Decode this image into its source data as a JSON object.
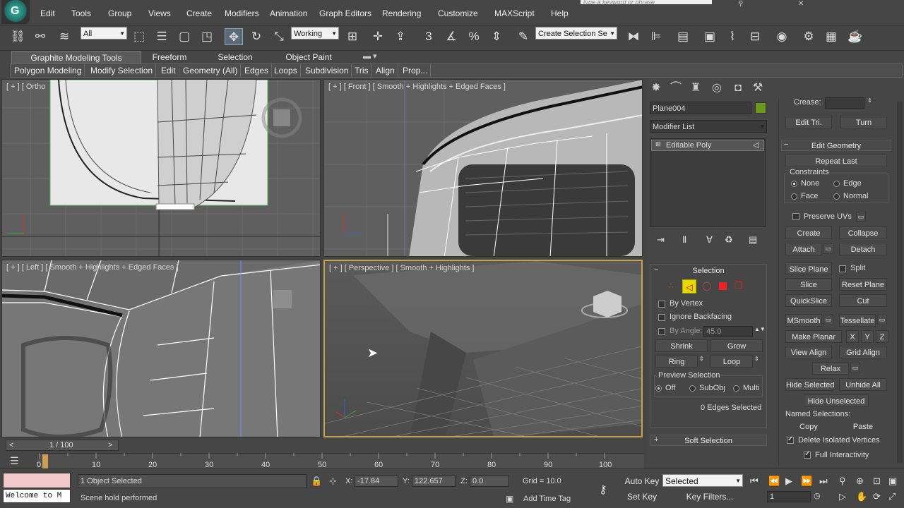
{
  "menubar": {
    "items": [
      "Edit",
      "Tools",
      "Group",
      "Views",
      "Create",
      "Modifiers",
      "Animation",
      "Graph Editors",
      "Rendering",
      "Customize",
      "MAXScript",
      "Help"
    ],
    "search_placeholder": "type a keyword or phrase"
  },
  "toolbar": {
    "selection_filter": "All",
    "coord_system": "Working",
    "snap_angle": "3",
    "named_selection": "Create Selection Se"
  },
  "ribbon": {
    "tabs": [
      "Graphite Modeling Tools",
      "Freeform",
      "Selection",
      "Object Paint"
    ],
    "subtabs": [
      "Polygon Modeling",
      "Modify Selection",
      "Edit",
      "Geometry (All)",
      "Edges",
      "Loops",
      "Subdivision",
      "Tris",
      "Align",
      "Prop..."
    ]
  },
  "viewports": {
    "top": "[ + ] [ Ortho",
    "front": "[ + ] [ Front ] [ Smooth + Highlights + Edged Faces ]",
    "left": "[ + ] [ Left ] [ Smooth + Highlights + Edged Faces ]",
    "perspective": "[ + ] [ Perspective ] [ Smooth + Highlights ]"
  },
  "command_panel": {
    "object_name": "Plane004",
    "object_color": "#6a9a1a",
    "modifier_list": "Modifier List",
    "stack_item": "Editable Poly",
    "selection": {
      "title": "Selection",
      "by_vertex": "By Vertex",
      "ignore_backfacing": "Ignore Backfacing",
      "by_angle": "By Angle:",
      "by_angle_value": "45.0",
      "shrink": "Shrink",
      "grow": "Grow",
      "ring": "Ring",
      "loop": "Loop",
      "preview_title": "Preview Selection",
      "preview_off": "Off",
      "preview_subobj": "SubObj",
      "preview_multi": "Multi",
      "count": "0 Edges Selected"
    },
    "soft_selection": "Soft Selection",
    "edit_geometry": {
      "crease": "Crease:",
      "edit_tri": "Edit Tri.",
      "turn": "Turn",
      "title": "Edit Geometry",
      "repeat_last": "Repeat Last",
      "constraints": "Constraints",
      "none": "None",
      "edge": "Edge",
      "face": "Face",
      "normal": "Normal",
      "preserve_uvs": "Preserve UVs",
      "create": "Create",
      "collapse": "Collapse",
      "attach": "Attach",
      "detach": "Detach",
      "slice_plane": "Slice Plane",
      "split": "Split",
      "slice": "Slice",
      "reset_plane": "Reset Plane",
      "quickslice": "QuickSlice",
      "cut": "Cut",
      "msmooth": "MSmooth",
      "tessellate": "Tessellate",
      "make_planar": "Make Planar",
      "x": "X",
      "y": "Y",
      "z": "Z",
      "view_align": "View Align",
      "grid_align": "Grid Align",
      "relax": "Relax",
      "hide_selected": "Hide Selected",
      "unhide_all": "Unhide All",
      "hide_unselected": "Hide Unselected",
      "named_selections": "Named Selections:",
      "copy": "Copy",
      "paste": "Paste",
      "delete_isolated": "Delete Isolated Vertices",
      "full_interactivity": "Full Interactivity"
    }
  },
  "timeline": {
    "frame_display": "1 / 100",
    "ticks": [
      "0",
      "10",
      "20",
      "30",
      "40",
      "50",
      "60",
      "70",
      "80",
      "90",
      "100"
    ]
  },
  "status": {
    "maxscript": "Welcome to M",
    "selected": "1 Object Selected",
    "prompt": "Scene hold performed",
    "x_label": "X:",
    "x_value": "-17.84",
    "y_label": "Y:",
    "y_value": "122.657",
    "z_label": "Z:",
    "z_value": "0.0",
    "grid": "Grid = 10.0",
    "add_time_tag": "Add Time Tag",
    "auto_key": "Auto Key",
    "set_key": "Set Key",
    "key_mode": "Selected",
    "key_filters": "Key Filters...",
    "frame": "1"
  }
}
